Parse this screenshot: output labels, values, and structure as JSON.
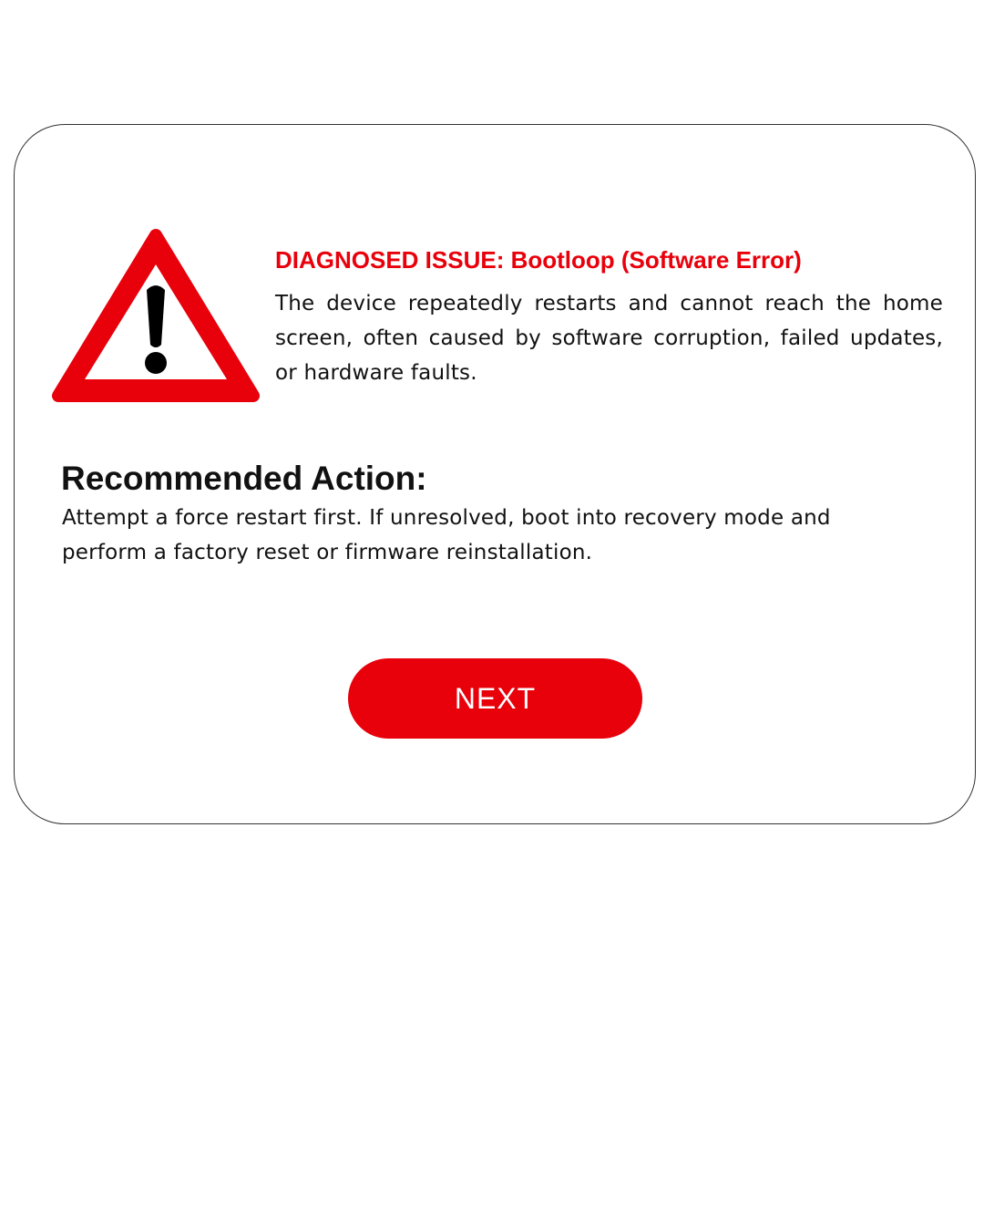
{
  "issue": {
    "title": "DIAGNOSED ISSUE: Bootloop (Software Error)",
    "description": "The device repeatedly restarts and cannot reach the home screen, often caused by software corruption, failed updates, or hardware faults."
  },
  "action": {
    "title": "Recommended Action:",
    "description": "Attempt a force restart first. If unresolved, boot into recovery mode and perform a factory reset or firmware reinstallation."
  },
  "buttons": {
    "next_label": "NEXT"
  },
  "icons": {
    "warning": "warning-triangle-icon"
  },
  "colors": {
    "accent": "#e8000b",
    "text": "#111111",
    "background": "#ffffff"
  }
}
